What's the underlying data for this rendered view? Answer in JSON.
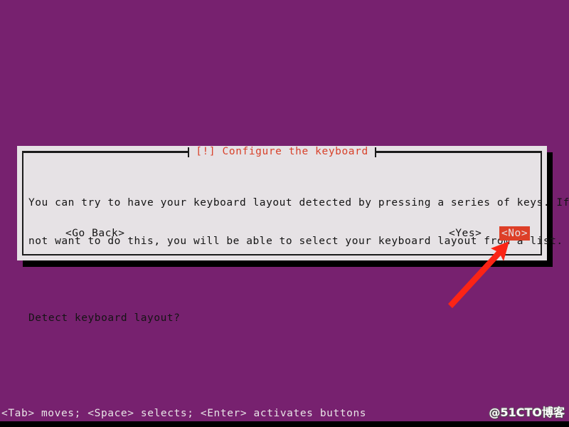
{
  "screen": {
    "background_color": "#77216f",
    "bottom_strip_color": "#000000"
  },
  "dialog": {
    "title": "[!] Configure the keyboard",
    "title_color": "#d8412a",
    "background_color": "#e6e2e5",
    "border_color": "#1b1b1b",
    "body_lines": [
      "You can try to have your keyboard layout detected by pressing a series of keys. If you do",
      "not want to do this, you will be able to select your keyboard layout from a list."
    ],
    "question": "Detect keyboard layout?",
    "buttons": [
      {
        "label": "<Go Back>",
        "selected": false
      },
      {
        "label": "<Yes>",
        "selected": false
      },
      {
        "label": "<No>",
        "selected": true,
        "highlight_color": "#dd3f28",
        "text_color": "#e6e2e5"
      }
    ]
  },
  "hint_bar": {
    "text": "<Tab> moves; <Space> selects; <Enter> activates buttons",
    "text_color": "#e8e4e6"
  },
  "annotation": {
    "arrow_color": "#fb2415",
    "points_to": "<No>"
  },
  "watermark": {
    "text": "@51CTO博客"
  }
}
